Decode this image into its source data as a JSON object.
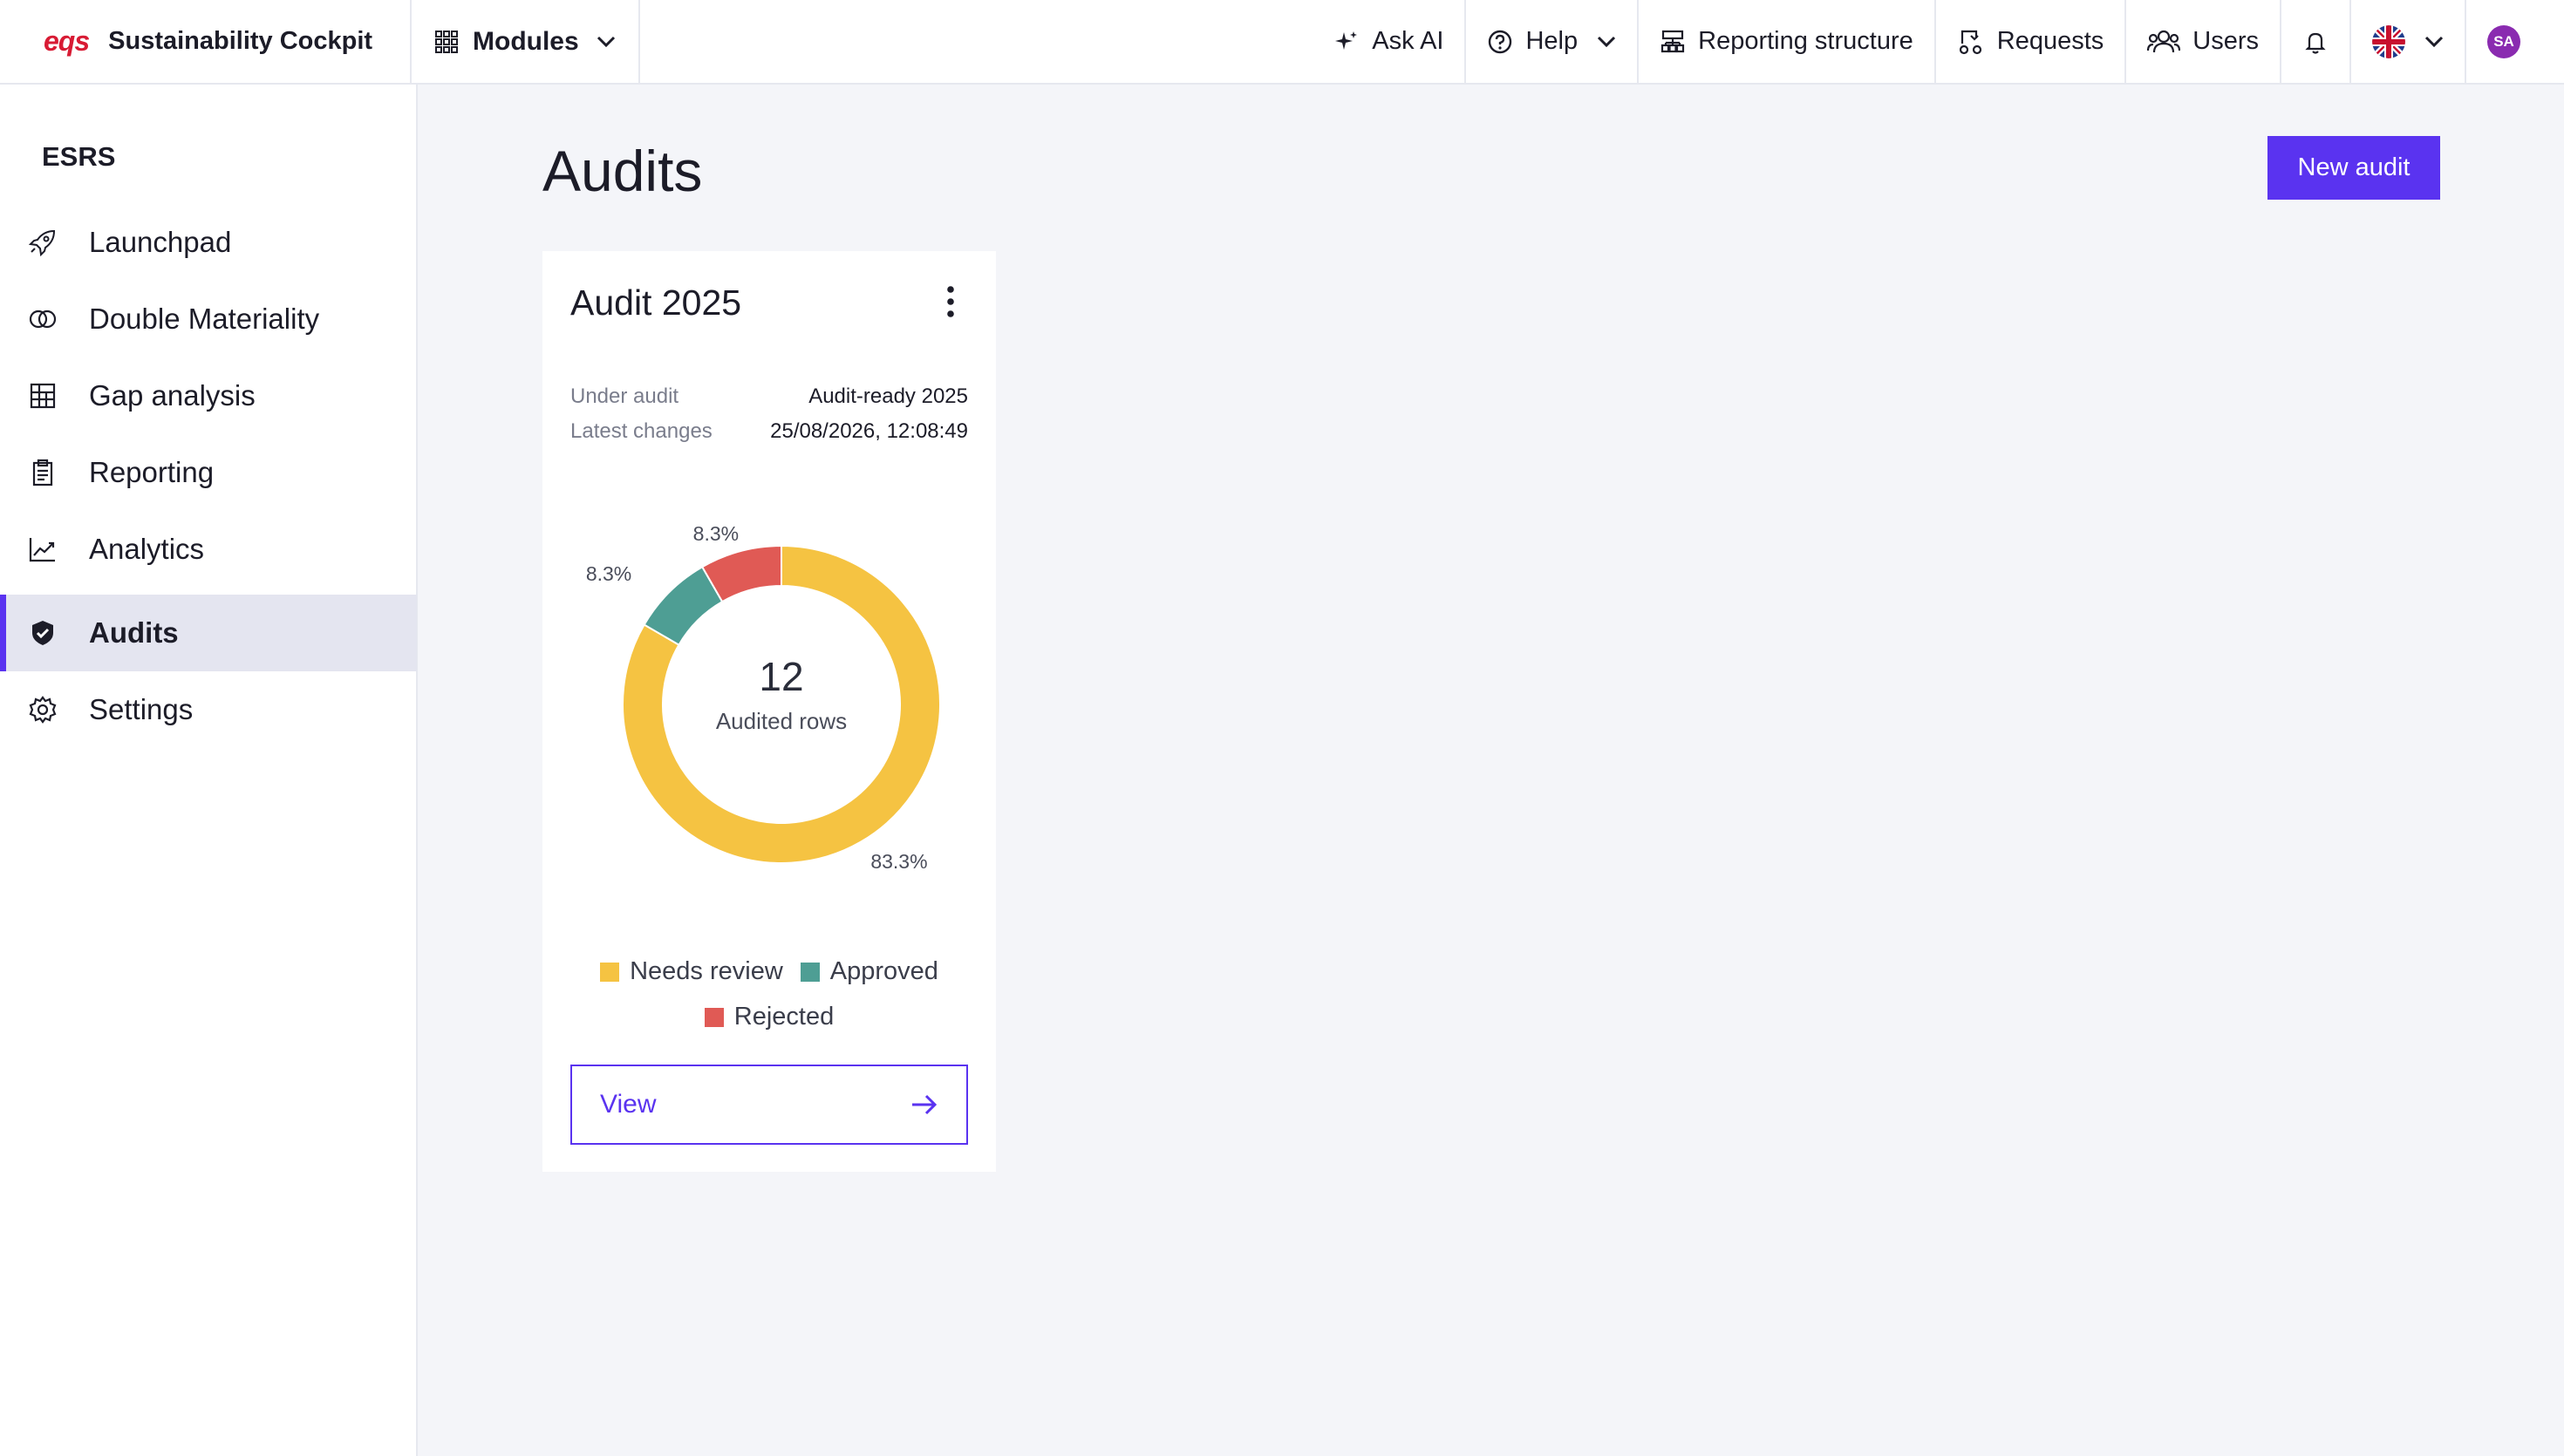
{
  "app": {
    "logo_text": "EQS",
    "title": "Sustainability Cockpit"
  },
  "topnav": {
    "modules_label": "Modules",
    "ask_ai_label": "Ask AI",
    "help_label": "Help",
    "reporting_structure_label": "Reporting structure",
    "requests_label": "Requests",
    "users_label": "Users",
    "avatar_initials": "SA"
  },
  "sidebar": {
    "section": "ESRS",
    "items": [
      {
        "label": "Launchpad",
        "icon": "rocket-icon",
        "active": false
      },
      {
        "label": "Double Materiality",
        "icon": "double-circle-icon",
        "active": false
      },
      {
        "label": "Gap analysis",
        "icon": "grid-table-icon",
        "active": false
      },
      {
        "label": "Reporting",
        "icon": "clipboard-icon",
        "active": false
      },
      {
        "label": "Analytics",
        "icon": "line-chart-icon",
        "active": false
      },
      {
        "label": "Audits",
        "icon": "shield-check-icon",
        "active": true
      },
      {
        "label": "Settings",
        "icon": "gear-icon",
        "active": false
      }
    ]
  },
  "main": {
    "title": "Audits",
    "new_audit_label": "New audit"
  },
  "audit_card": {
    "title": "Audit 2025",
    "under_audit_label": "Under audit",
    "under_audit_value": "Audit-ready 2025",
    "latest_changes_label": "Latest changes",
    "latest_changes_value": "25/08/2026, 12:08:49",
    "center_count": "12",
    "center_label": "Audited rows",
    "view_label": "View"
  },
  "chart_data": {
    "type": "pie",
    "donut": true,
    "categories": [
      "Needs review",
      "Approved",
      "Rejected"
    ],
    "values": [
      83.3,
      8.3,
      8.3
    ],
    "data_labels": [
      "83.3%",
      "8.3%",
      "8.3%"
    ],
    "colors": [
      "#f5c342",
      "#4e9e94",
      "#e05a55"
    ],
    "legend": "bottom"
  },
  "colors": {
    "accent": "#5a33f0",
    "brand": "#d81b34"
  }
}
